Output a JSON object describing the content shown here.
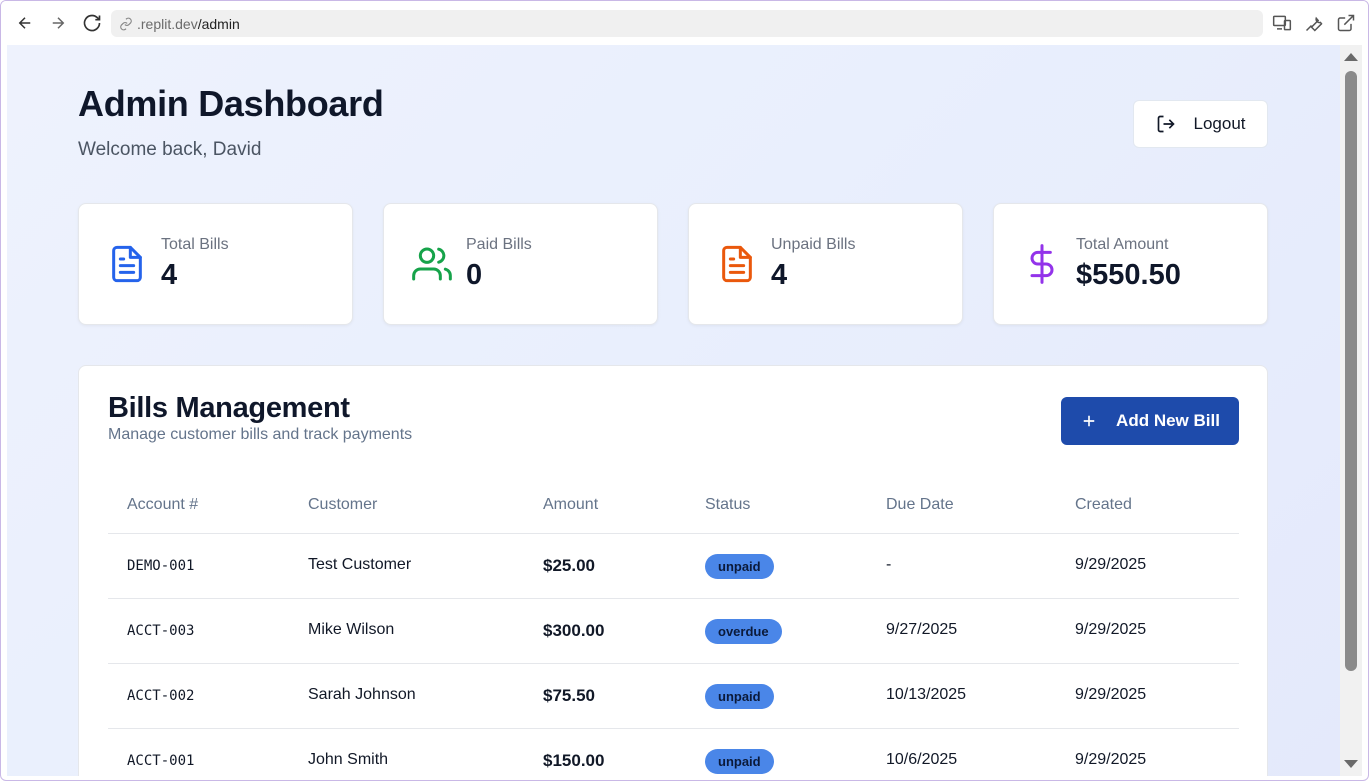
{
  "browser": {
    "url_host": ".replit.dev",
    "url_path": "/admin"
  },
  "header": {
    "title": "Admin Dashboard",
    "subtitle": "Welcome back, David",
    "logout_label": "Logout"
  },
  "stats": [
    {
      "label": "Total Bills",
      "value": "4",
      "icon": "file-text-icon",
      "color": "#2563eb"
    },
    {
      "label": "Paid Bills",
      "value": "0",
      "icon": "users-icon",
      "color": "#16a34a"
    },
    {
      "label": "Unpaid Bills",
      "value": "4",
      "icon": "file-text-icon",
      "color": "#ea580c"
    },
    {
      "label": "Total Amount",
      "value": "$550.50",
      "icon": "dollar-sign-icon",
      "color": "#9333ea"
    }
  ],
  "bills": {
    "title": "Bills Management",
    "subtitle": "Manage customer bills and track payments",
    "add_label": "Add New Bill",
    "columns": [
      "Account #",
      "Customer",
      "Amount",
      "Status",
      "Due Date",
      "Created"
    ],
    "rows": [
      {
        "account": "DEMO-001",
        "customer": "Test Customer",
        "amount": "$25.00",
        "status": "unpaid",
        "due": "-",
        "created": "9/29/2025"
      },
      {
        "account": "ACCT-003",
        "customer": "Mike Wilson",
        "amount": "$300.00",
        "status": "overdue",
        "due": "9/27/2025",
        "created": "9/29/2025"
      },
      {
        "account": "ACCT-002",
        "customer": "Sarah Johnson",
        "amount": "$75.50",
        "status": "unpaid",
        "due": "10/13/2025",
        "created": "9/29/2025"
      },
      {
        "account": "ACCT-001",
        "customer": "John Smith",
        "amount": "$150.00",
        "status": "unpaid",
        "due": "10/6/2025",
        "created": "9/29/2025"
      }
    ]
  },
  "colors": {
    "primary": "#1e4bab",
    "badge": "#4a86e8"
  }
}
